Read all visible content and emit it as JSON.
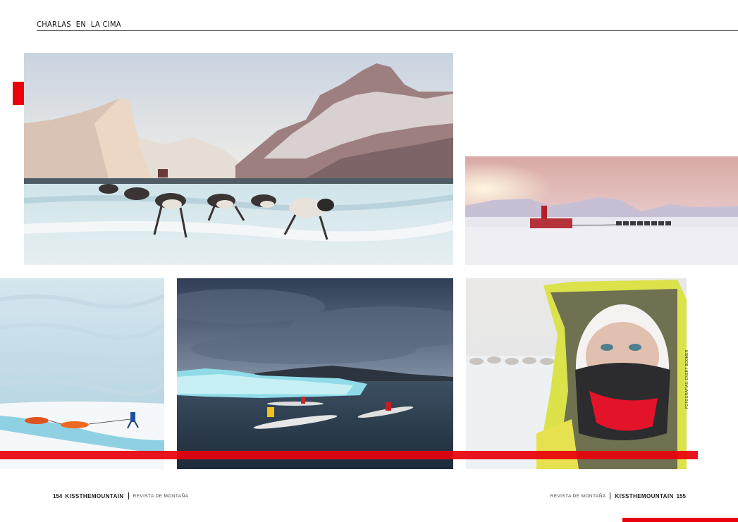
{
  "header": {
    "section_title": "CHARLAS  EN  LA CIMA"
  },
  "photos": {
    "dogsled_mountains": "dog-sled-team-on-frozen-fjord",
    "sled_sunset": "sled-and-dogs-at-sunset",
    "ice_pulk": "skier-pulling-pulks-on-ice",
    "kayaks_iceberg": "kayakers-near-iceberg",
    "frozen_face": "frost-covered-explorer-portrait"
  },
  "photo_credit": "FOTOGRAFÍAS: EVERT BOOMER",
  "footer_left": {
    "page": "154",
    "brand": "KISSTHEMOUNTAIN",
    "magazine": "REVISTA DE MONTAÑA"
  },
  "footer_right": {
    "magazine": "REVISTA DE MONTAÑA",
    "brand": "KISSTHEMOUNTAIN",
    "page": "155"
  },
  "colors": {
    "accent": "#e8000b",
    "rule": "#555555",
    "text": "#111111"
  }
}
